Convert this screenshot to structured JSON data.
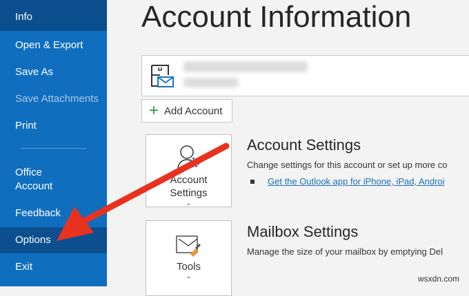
{
  "sidebar": {
    "items": [
      {
        "label": "Info"
      },
      {
        "label": "Open & Export"
      },
      {
        "label": "Save As"
      },
      {
        "label": "Save Attachments"
      },
      {
        "label": "Print"
      },
      {
        "label": "Office Account"
      },
      {
        "label": "Feedback"
      },
      {
        "label": "Options"
      },
      {
        "label": "Exit"
      }
    ]
  },
  "main": {
    "title": "Account Information",
    "add_account": "Add Account",
    "account_settings": {
      "tile_label": "Account Settings",
      "heading": "Account Settings",
      "description": "Change settings for this account or set up more co",
      "link": "Get the Outlook app for iPhone, iPad, Androi"
    },
    "mailbox_settings": {
      "tile_label": "Tools",
      "heading": "Mailbox Settings",
      "description": "Manage the size of your mailbox by emptying Del"
    }
  },
  "watermark": "wsxdn.com",
  "colors": {
    "sidebar": "#106ebe",
    "selected": "#0b4f8e",
    "arrow": "#e8321f"
  }
}
